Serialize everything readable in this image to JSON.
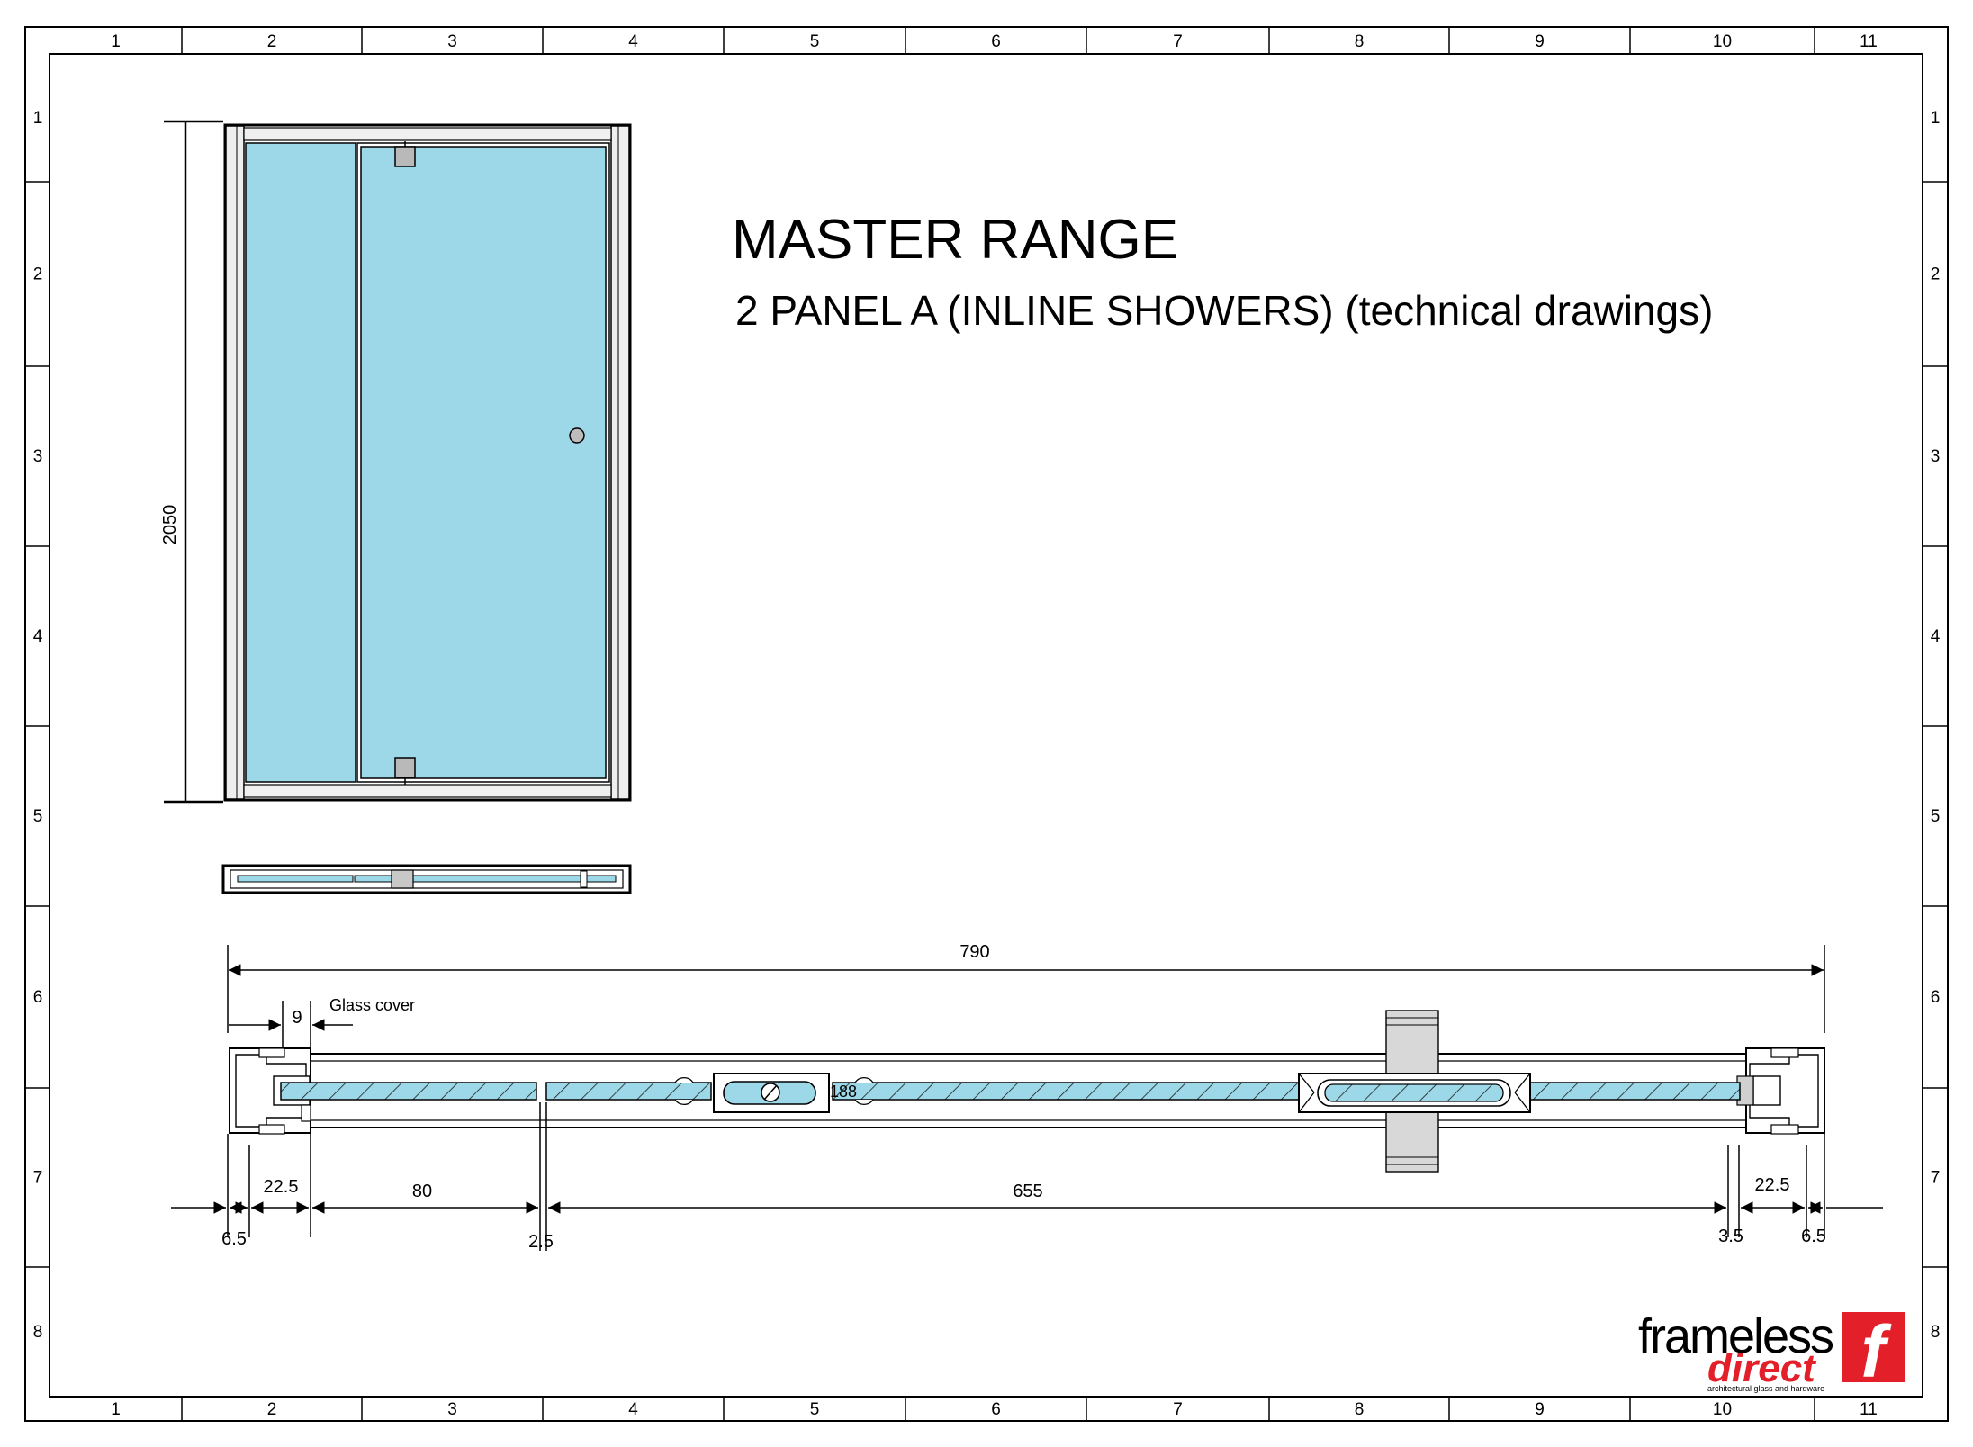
{
  "title": "MASTER RANGE",
  "subtitle": "2 PANEL  A (INLINE SHOWERS) (technical drawings)",
  "grid": {
    "columns": [
      "1",
      "2",
      "3",
      "4",
      "5",
      "6",
      "7",
      "8",
      "9",
      "10",
      "11"
    ],
    "rows": [
      "1",
      "2",
      "3",
      "4",
      "5",
      "6",
      "7",
      "8"
    ]
  },
  "elevation": {
    "height_dim": "2050"
  },
  "section": {
    "overall_width": "790",
    "glass_cover_label": "Glass cover",
    "glass_cover_dim": "9",
    "left_profile": "22.5",
    "left_offset": "6.5",
    "fixed_panel": "80",
    "gap": "2.5",
    "door_panel": "655",
    "right_gap": "3.5",
    "right_profile": "22.5",
    "right_offset": "6.5",
    "hinge_angle": "188"
  },
  "logo": {
    "word1": "frameless",
    "word2": "direct",
    "tagline": "architectural glass and hardware",
    "mark": "f"
  },
  "colors": {
    "glass": "#9dd8e8",
    "brand_red": "#e3202a",
    "line": "#000000"
  }
}
